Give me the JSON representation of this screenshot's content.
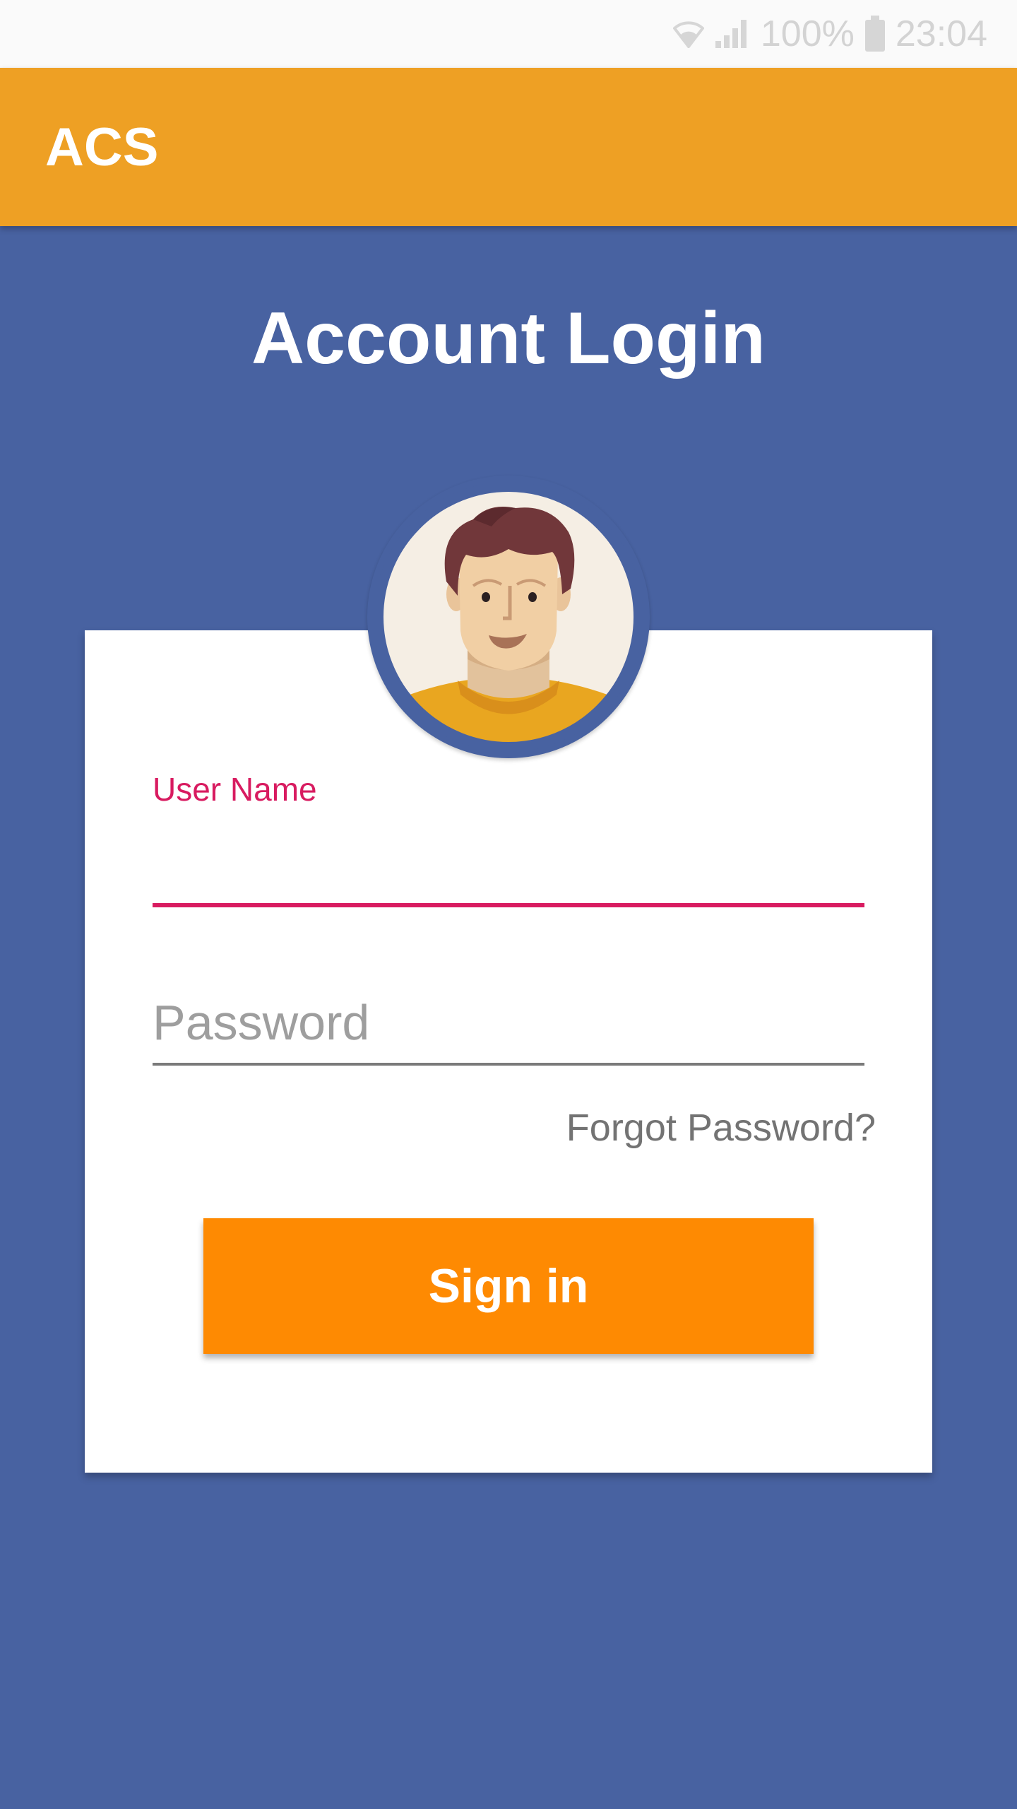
{
  "status_bar": {
    "battery": "100%",
    "time": "23:04",
    "icons": [
      "wifi-icon",
      "signal-icon",
      "battery-icon"
    ]
  },
  "app_bar": {
    "title": "ACS",
    "color": "#eea024"
  },
  "login": {
    "title": "Account Login",
    "avatar_icon": "user-avatar-icon",
    "username": {
      "label": "User Name",
      "value": "",
      "accent_color": "#d81b60"
    },
    "password": {
      "placeholder": "Password",
      "value": ""
    },
    "forgot_password": "Forgot Password?",
    "sign_in": "Sign in",
    "button_color": "#fe8a02"
  },
  "theme": {
    "background": "#4862a1",
    "card": "#ffffff"
  }
}
